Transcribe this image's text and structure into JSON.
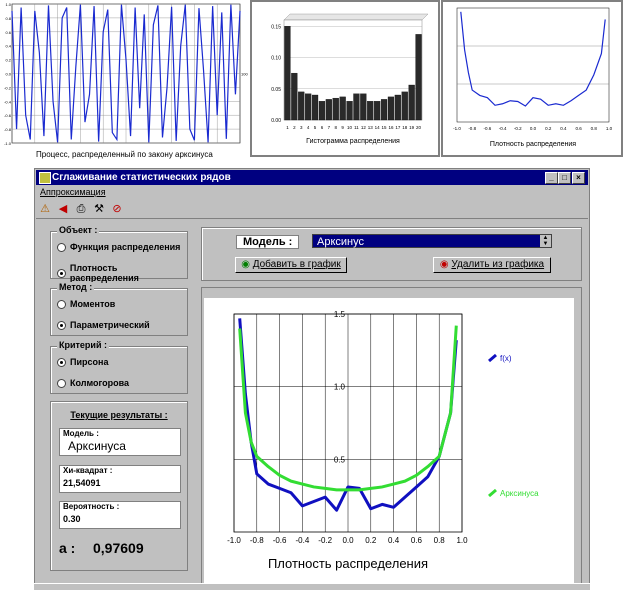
{
  "top_left": {
    "caption": "Процесс, распределенный по закону арксинуса",
    "y_ticks": [
      "1.0",
      "0.8",
      "0.6",
      "0.4",
      "0.2",
      "0.0",
      "-0.2",
      "-0.4",
      "-0.6",
      "-0.8",
      "-1.0"
    ],
    "right_tick": "100"
  },
  "top_middle": {
    "title": "Гистограмма распределения",
    "y_ticks": [
      "0.15",
      "0.10",
      "0.05",
      "0.00"
    ],
    "x_ticks": [
      "1",
      "2",
      "3",
      "4",
      "5",
      "6",
      "7",
      "8",
      "9",
      "10",
      "11",
      "12",
      "13",
      "14",
      "15",
      "16",
      "17",
      "18",
      "19",
      "20"
    ]
  },
  "top_right": {
    "title": "Плотность распределения",
    "x_ticks": [
      "-1.0",
      "-0.8",
      "-0.6",
      "-0.4",
      "-0.2",
      "0.0",
      "0.2",
      "0.4",
      "0.6",
      "0.8",
      "1.0"
    ]
  },
  "window": {
    "title": "Сглаживание статистических рядов",
    "menu": "Аппроксимация",
    "object_group": {
      "label": "Объект :",
      "options": [
        "Функция распределения",
        "Плотность распределения"
      ],
      "selected": 1
    },
    "method_group": {
      "label": "Метод :",
      "options": [
        "Моментов",
        "Параметрический"
      ],
      "selected": 1
    },
    "criterion_group": {
      "label": "Критерий :",
      "options": [
        "Пирсона",
        "Колмогорова"
      ],
      "selected": 0
    },
    "results": {
      "heading": "Текущие результаты :",
      "model_label": "Модель :",
      "model_value": "Арксинуса",
      "chi_label": "Хи-квадрат :",
      "chi_value": "21,54091",
      "prob_label": "Вероятность :",
      "prob_value": "0.30",
      "a_label": "a :",
      "a_value": "0,97609"
    },
    "model_selector": {
      "label": "Модель :",
      "value": "Арксинус"
    },
    "add_button": "Добавить в график",
    "remove_button": "Удалить из графика",
    "plot": {
      "title": "Плотность распределения",
      "legend": [
        "f(x)",
        "Арксинуса"
      ]
    }
  },
  "colors": {
    "title_bar": "#000080",
    "window_bg": "#c0c0c0",
    "series_fx": "#1010c0",
    "series_fit": "#33dd33",
    "process_line": "#1a2ad0",
    "hist_bar": "#2a2a2a"
  },
  "chart_data": [
    {
      "type": "line",
      "title": "",
      "ylim": [
        -1.0,
        1.0
      ],
      "x": [
        0,
        2,
        4,
        6,
        8,
        10,
        12,
        14,
        16,
        18,
        20,
        22,
        24,
        26,
        28,
        30,
        32,
        34,
        36,
        38,
        40,
        42,
        44,
        46,
        48,
        50,
        52,
        54,
        56,
        58,
        60,
        62,
        64,
        66,
        68,
        70,
        72,
        74,
        76,
        78,
        80,
        82,
        84,
        86,
        88,
        90,
        92,
        94,
        96,
        98,
        100
      ],
      "series": [
        {
          "values": [
            0.9,
            -0.8,
            0.95,
            -0.6,
            -0.95,
            0.9,
            0.3,
            -0.9,
            0.98,
            -0.4,
            -0.99,
            0.8,
            0.95,
            -0.95,
            0.1,
            0.99,
            -0.7,
            -0.3,
            0.97,
            -0.98,
            0.6,
            0.92,
            -0.85,
            -0.95,
            0.99,
            0.2,
            -0.9,
            0.95,
            -0.5,
            0.85,
            -0.99,
            0.7,
            0.98,
            -0.92,
            -0.2,
            0.96,
            -0.97,
            0.4,
            0.99,
            -0.8,
            -0.96,
            0.94,
            0.05,
            -0.99,
            0.97,
            -0.6,
            0.88,
            -0.94,
            0.99,
            -0.3,
            0.9
          ]
        }
      ]
    },
    {
      "type": "bar",
      "title": "Гистограмма распределения",
      "categories": [
        "1",
        "2",
        "3",
        "4",
        "5",
        "6",
        "7",
        "8",
        "9",
        "10",
        "11",
        "12",
        "13",
        "14",
        "15",
        "16",
        "17",
        "18",
        "19",
        "20"
      ],
      "values": [
        0.15,
        0.075,
        0.045,
        0.042,
        0.04,
        0.03,
        0.033,
        0.035,
        0.037,
        0.03,
        0.042,
        0.042,
        0.03,
        0.03,
        0.033,
        0.037,
        0.04,
        0.045,
        0.056,
        0.137
      ],
      "ylim": [
        0,
        0.16
      ]
    },
    {
      "type": "line",
      "title": "Плотность распределения",
      "x": [
        -0.95,
        -0.9,
        -0.85,
        -0.8,
        -0.7,
        -0.6,
        -0.5,
        -0.4,
        -0.3,
        -0.2,
        -0.1,
        0.0,
        0.1,
        0.2,
        0.3,
        0.4,
        0.5,
        0.6,
        0.7,
        0.8,
        0.9,
        0.95
      ],
      "series": [
        {
          "values": [
            1.45,
            0.95,
            0.65,
            0.42,
            0.35,
            0.32,
            0.22,
            0.24,
            0.28,
            0.27,
            0.21,
            0.32,
            0.3,
            0.22,
            0.24,
            0.22,
            0.28,
            0.35,
            0.42,
            0.62,
            0.9,
            1.35
          ]
        }
      ],
      "xlim": [
        -1.0,
        1.0
      ],
      "ylim": [
        0,
        1.5
      ]
    },
    {
      "type": "line",
      "title": "Плотность распределения",
      "x": [
        -0.95,
        -0.9,
        -0.85,
        -0.8,
        -0.7,
        -0.6,
        -0.5,
        -0.4,
        -0.3,
        -0.2,
        -0.1,
        0.0,
        0.1,
        0.2,
        0.3,
        0.4,
        0.5,
        0.6,
        0.7,
        0.8,
        0.9,
        0.95
      ],
      "series": [
        {
          "name": "f(x)",
          "values": [
            1.47,
            0.95,
            0.62,
            0.4,
            0.33,
            0.3,
            0.27,
            0.18,
            0.21,
            0.24,
            0.15,
            0.31,
            0.3,
            0.16,
            0.19,
            0.17,
            0.24,
            0.31,
            0.38,
            0.52,
            0.82,
            1.32
          ]
        },
        {
          "name": "Арксинуса",
          "values": [
            1.4,
            0.82,
            0.62,
            0.52,
            0.45,
            0.39,
            0.35,
            0.33,
            0.31,
            0.3,
            0.29,
            0.29,
            0.29,
            0.3,
            0.31,
            0.33,
            0.35,
            0.39,
            0.45,
            0.52,
            0.82,
            1.42
          ]
        }
      ],
      "xlim": [
        -1.0,
        1.0
      ],
      "ylim": [
        0,
        1.5
      ],
      "x_ticks": [
        "-1.0",
        "-0.8",
        "-0.6",
        "-0.4",
        "-0.2",
        "0.0",
        "0.2",
        "0.4",
        "0.6",
        "0.8",
        "1.0"
      ],
      "y_ticks": [
        "0.5",
        "1.0",
        "1.5"
      ],
      "legend": "right"
    }
  ]
}
